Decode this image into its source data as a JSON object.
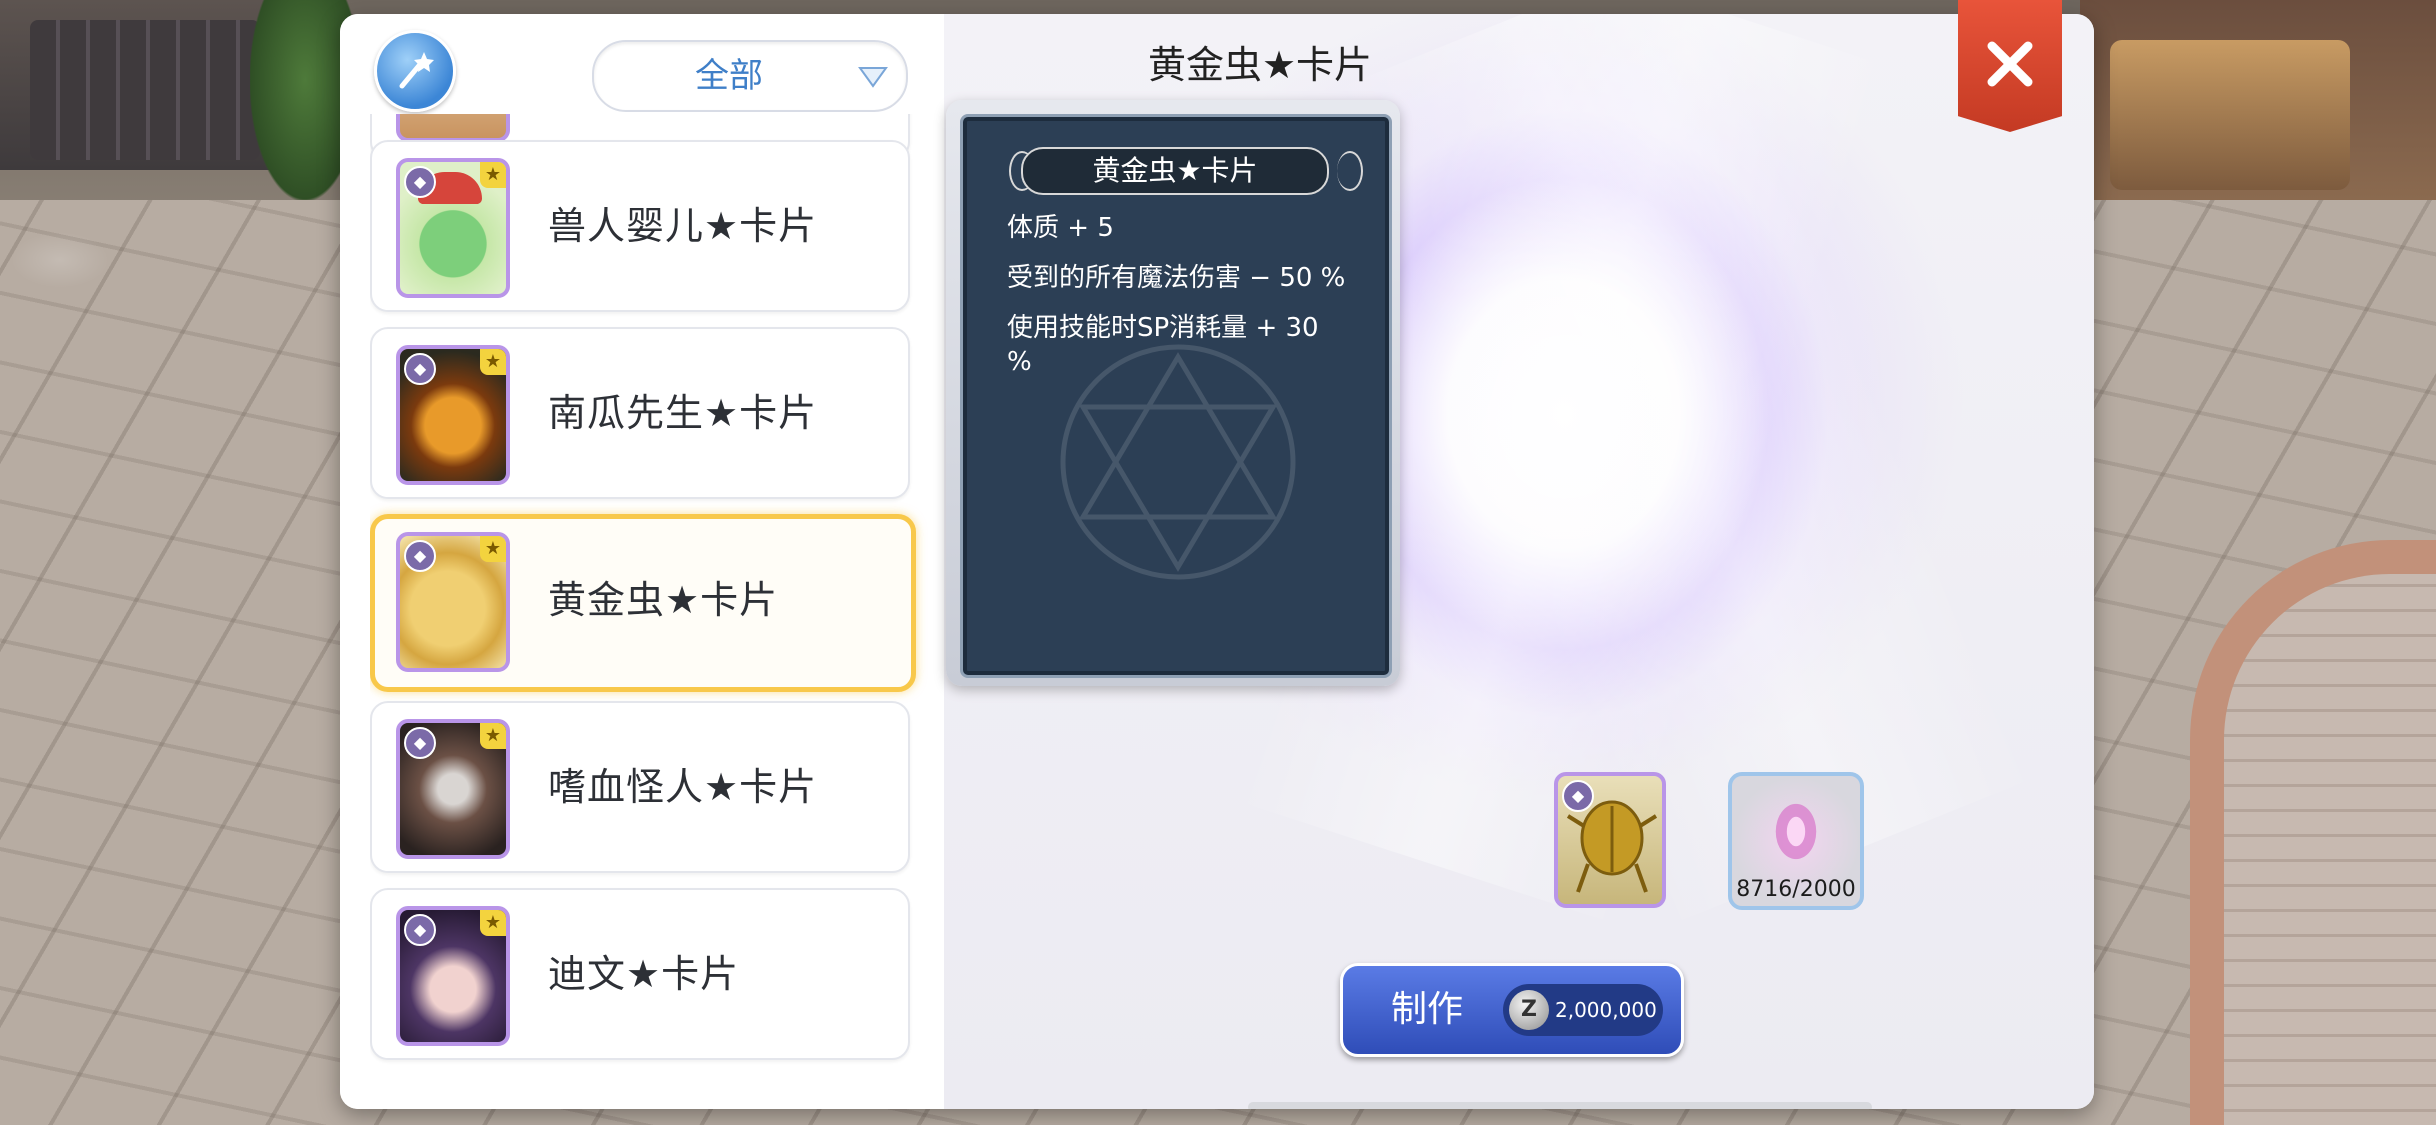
{
  "filter": {
    "label": "全部"
  },
  "cards": [
    {
      "name": "",
      "selected": false
    },
    {
      "name": "兽人婴儿★卡片",
      "selected": false
    },
    {
      "name": "南瓜先生★卡片",
      "selected": false
    },
    {
      "name": "黄金虫★卡片",
      "selected": true
    },
    {
      "name": "嗜血怪人★卡片",
      "selected": false
    },
    {
      "name": "迪文★卡片",
      "selected": false
    }
  ],
  "detail": {
    "title": "黄金虫★卡片",
    "card_title": "黄金虫★卡片",
    "effects": [
      "体质 + 5",
      "受到的所有魔法伤害 − 50 %",
      "使用技能时SP消耗量 + 30 %"
    ]
  },
  "materials": {
    "shard_count": "8716/2000"
  },
  "craft": {
    "label": "制作",
    "cost": "2,000,000",
    "currency_symbol": "Z"
  },
  "icons": {
    "magic": "magic-wand-icon",
    "dropdown": "triangle-down-icon",
    "close": "close-icon",
    "zeny": "zeny-coin-icon"
  },
  "colors": {
    "accent_blue": "#3f7fc8",
    "selected_border": "#f8c84a",
    "close_red": "#d9472e",
    "thumb_border": "#b995e8"
  }
}
